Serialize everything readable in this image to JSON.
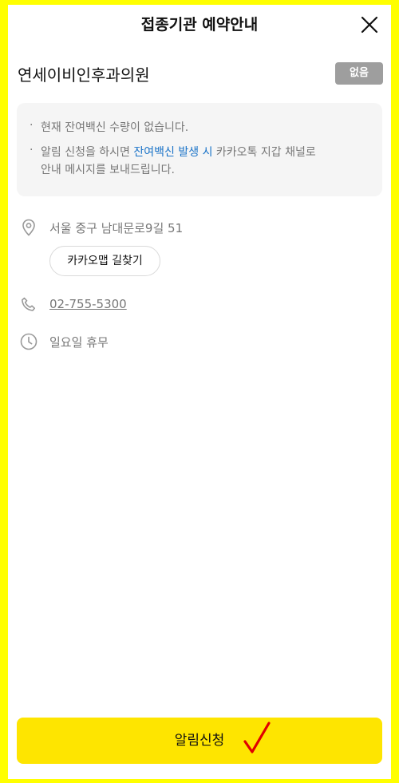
{
  "header": {
    "title": "접종기관 예약안내",
    "close_icon": "close-icon"
  },
  "clinic": {
    "name": "연세이비인후과의원",
    "badge": "없음",
    "badge_color": "#9e9e9e"
  },
  "notice": {
    "line1": "현재 잔여백신 수량이 없습니다.",
    "line2_prefix": "알림 신청을 하시면 ",
    "line2_highlight": "잔여백신 발생 시",
    "line2_suffix": " 카카오톡 지갑 채널로",
    "line2_cont": "안내 메시지를 보내드립니다.",
    "highlight_color": "#1a73c8"
  },
  "details": {
    "address": "서울 중구 남대문로9길 51",
    "address_icon": "location-pin-icon",
    "map_button": "카카오맵 길찾기",
    "phone": "02-755-5300",
    "phone_icon": "phone-icon",
    "hours": "일요일 휴무",
    "hours_icon": "clock-icon"
  },
  "footer": {
    "apply_button": "알림신청",
    "button_color": "#FEE500",
    "annotation_icon": "red-checkmark-icon"
  },
  "frame_color": "#FFFF00"
}
